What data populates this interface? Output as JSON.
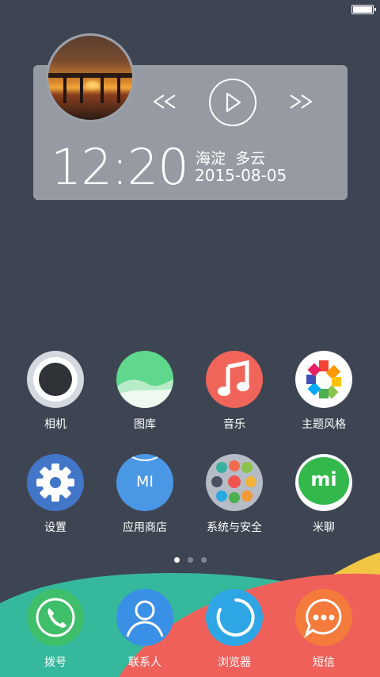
{
  "status": {
    "battery": "full"
  },
  "music_widget": {
    "album_art": "sunset-pier",
    "prev_icon": "rewind-icon",
    "play_icon": "play-icon",
    "next_icon": "fast-forward-icon"
  },
  "clock": {
    "time": "12:20",
    "location": "海淀",
    "weather": "多云",
    "date": "2015-08-05"
  },
  "apps_row1": [
    {
      "label": "相机",
      "icon": "camera-icon"
    },
    {
      "label": "图库",
      "icon": "gallery-icon"
    },
    {
      "label": "音乐",
      "icon": "music-icon"
    },
    {
      "label": "主题风格",
      "icon": "theme-icon"
    }
  ],
  "apps_row2": [
    {
      "label": "设置",
      "icon": "settings-icon"
    },
    {
      "label": "应用商店",
      "icon": "app-store-icon",
      "badge": "MI"
    },
    {
      "label": "系统与安全",
      "icon": "system-folder-icon"
    },
    {
      "label": "米聊",
      "icon": "miliao-icon",
      "badge": "mi"
    }
  ],
  "page_indicator": {
    "count": 3,
    "active": 0
  },
  "dock": [
    {
      "label": "拨号",
      "icon": "phone-icon"
    },
    {
      "label": "联系人",
      "icon": "contacts-icon"
    },
    {
      "label": "浏览器",
      "icon": "browser-icon"
    },
    {
      "label": "短信",
      "icon": "messages-icon"
    }
  ],
  "colors": {
    "background": "#3e4552",
    "dock_green": "#36b89c",
    "dock_red": "#f0605a",
    "dock_yellow": "#f0c642"
  }
}
